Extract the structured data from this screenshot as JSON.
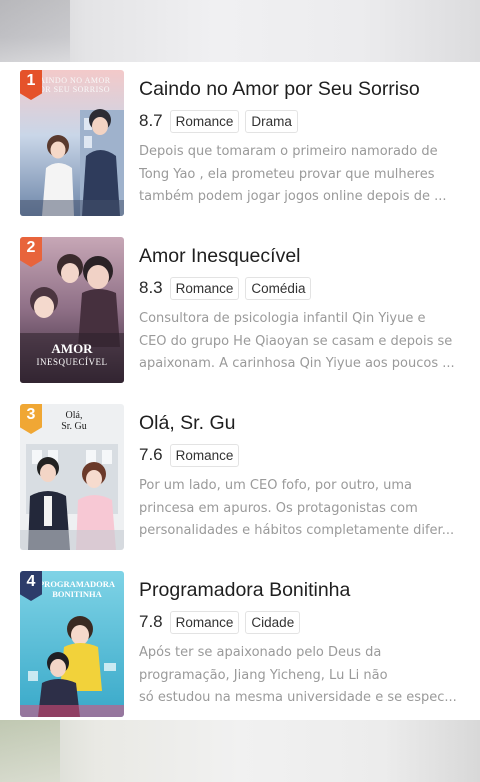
{
  "list": [
    {
      "rank": "1",
      "rank_color": "#e5522a",
      "cover_caption": [
        "CAINDO NO AMOR",
        "POR SEU SORRISO"
      ],
      "title": "Caindo no Amor por Seu Sorriso",
      "score": "8.7",
      "tags": [
        "Romance",
        "Drama"
      ],
      "description": [
        "Depois que tomaram o primeiro namorado de",
        "Tong Yao , ela prometeu provar que mulheres",
        "também podem jogar jogos online depois de ..."
      ]
    },
    {
      "rank": "2",
      "rank_color": "#e8643c",
      "cover_caption": [
        "AMOR",
        "INESQUECÍVEL"
      ],
      "title": "Amor Inesquecível",
      "score": "8.3",
      "tags": [
        "Romance",
        "Comédia"
      ],
      "description": [
        "Consultora de psicologia infantil Qin Yiyue e",
        "CEO do grupo He Qiaoyan se casam e depois se",
        "apaixonam. A carinhosa Qin Yiyue aos poucos ..."
      ]
    },
    {
      "rank": "3",
      "rank_color": "#f0a734",
      "cover_caption": [
        "Olá,",
        "Sr. Gu"
      ],
      "title": "Olá, Sr. Gu",
      "score": "7.6",
      "tags": [
        "Romance"
      ],
      "description": [
        "Por um lado, um CEO fofo, por outro, uma",
        "princesa em apuros. Os protagonistas com",
        "personalidades e hábitos completamente difer..."
      ]
    },
    {
      "rank": "4",
      "rank_color": "#2d3c6a",
      "cover_caption": [
        "PROGRAMADORA",
        "BONITINHA"
      ],
      "title": "Programadora Bonitinha",
      "score": "7.8",
      "tags": [
        "Romance",
        "Cidade"
      ],
      "description": [
        "Após ter se apaixonado pelo Deus da",
        "programação, Jiang Yicheng, Lu Li não",
        "só estudou na mesma universidade e se espec..."
      ]
    }
  ]
}
